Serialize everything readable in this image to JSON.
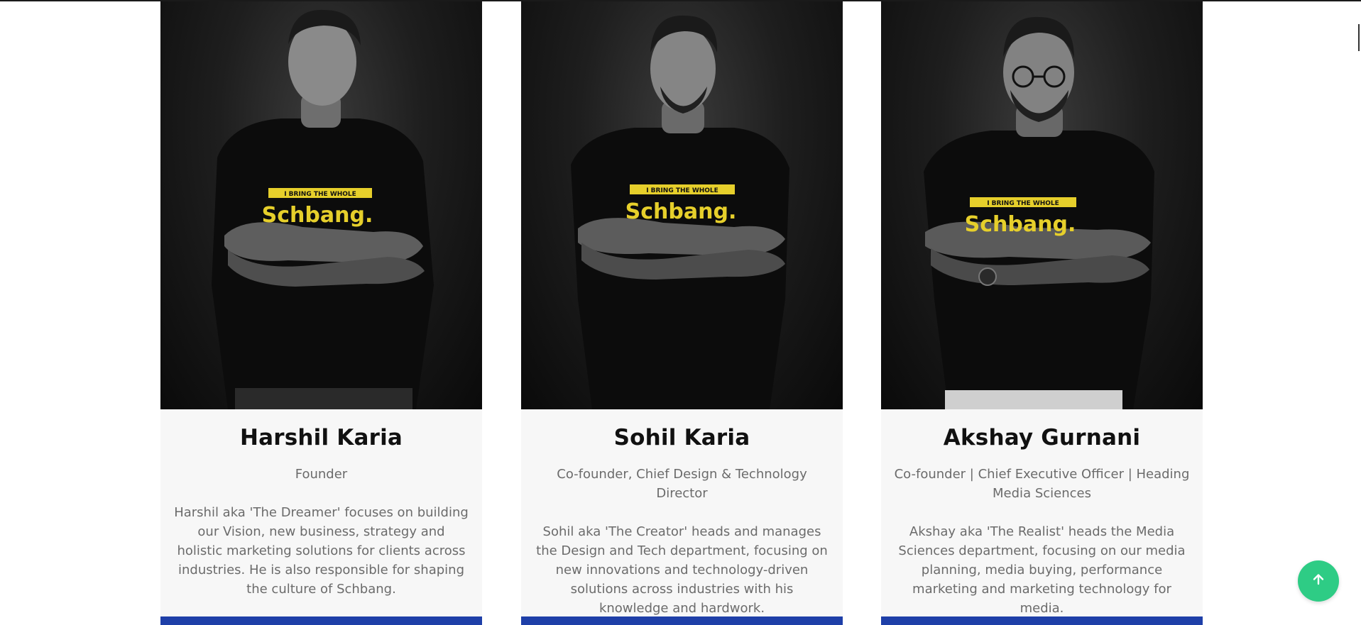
{
  "team": {
    "members": [
      {
        "name": "Harshil Karia",
        "role": "Founder",
        "bio": "Harshil aka 'The Dreamer' focuses on building our Vision, new business, strategy and holistic marketing solutions for clients across industries. He is also responsible for shaping the culture of Schbang.",
        "shirt_tagline": "I BRING THE WHOLE",
        "shirt_logo": "Schbang."
      },
      {
        "name": "Sohil Karia",
        "role": "Co-founder, Chief Design & Technology Director",
        "bio": "Sohil aka 'The Creator' heads and manages the Design and Tech department, focusing on new innovations and technology-driven solutions across industries with his knowledge and hardwork.",
        "shirt_tagline": "I BRING THE WHOLE",
        "shirt_logo": "Schbang."
      },
      {
        "name": "Akshay Gurnani",
        "role": "Co-founder | Chief Executive Officer | Heading Media Sciences",
        "bio": "Akshay aka 'The Realist' heads the Media Sciences department, focusing on our media planning, media buying, performance marketing and marketing technology for media.",
        "shirt_tagline": "I BRING THE WHOLE",
        "shirt_logo": "Schbang."
      }
    ]
  },
  "back_to_top": {
    "icon": "arrow-up-icon"
  },
  "colors": {
    "accent_bar": "#1e3fa8",
    "back_to_top": "#2ecc85",
    "shirt_print": "#e6cf2b"
  }
}
